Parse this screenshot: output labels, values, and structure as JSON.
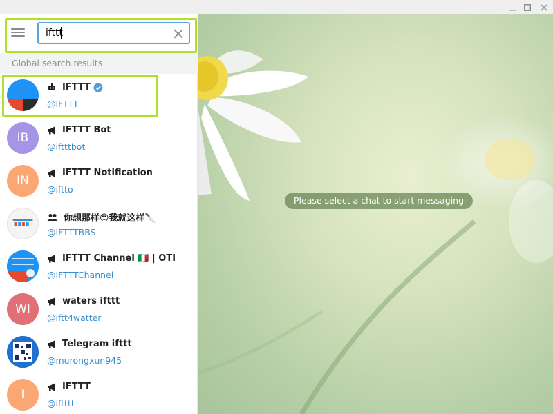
{
  "window": {
    "controls": [
      "minimize-icon",
      "maximize-icon",
      "close-icon"
    ]
  },
  "search": {
    "value": "ifttt"
  },
  "section_label": "Global search results",
  "empty_state": "Please select a chat to start messaging",
  "results": [
    {
      "title": "IFTTT",
      "username": "@IFTTT",
      "type_icon": "bot-icon",
      "verified": true,
      "avatar_initials": ""
    },
    {
      "title": "IFTTT Bot",
      "username": "@iftttbot",
      "type_icon": "megaphone-icon",
      "avatar_initials": "IB",
      "avatar_color": "#a695e7"
    },
    {
      "title": "IFTTT Notification",
      "username": "@iftto",
      "type_icon": "megaphone-icon",
      "avatar_initials": "IN",
      "avatar_color": "#faa774"
    },
    {
      "title": "你想那样😍我就这样🔪",
      "username": "@IFTTTBBS",
      "type_icon": "group-icon",
      "avatar_initials": ""
    },
    {
      "title": "IFTTT Channel 🇮🇹 | OTI",
      "username": "@IFTTTChannel",
      "type_icon": "megaphone-icon",
      "avatar_initials": ""
    },
    {
      "title": "waters ifttt",
      "username": "@iftt4watter",
      "type_icon": "megaphone-icon",
      "avatar_initials": "WI",
      "avatar_color": "#e17076"
    },
    {
      "title": "Telegram ifttt",
      "username": "@murongxun945",
      "type_icon": "megaphone-icon",
      "avatar_initials": ""
    },
    {
      "title": "IFTTT",
      "username": "@iftttt",
      "type_icon": "megaphone-icon",
      "avatar_initials": "I",
      "avatar_color": "#faa774"
    }
  ],
  "colors": {
    "accent": "#54a5e0",
    "link": "#3b8dcc",
    "highlight": "#b1e027"
  }
}
